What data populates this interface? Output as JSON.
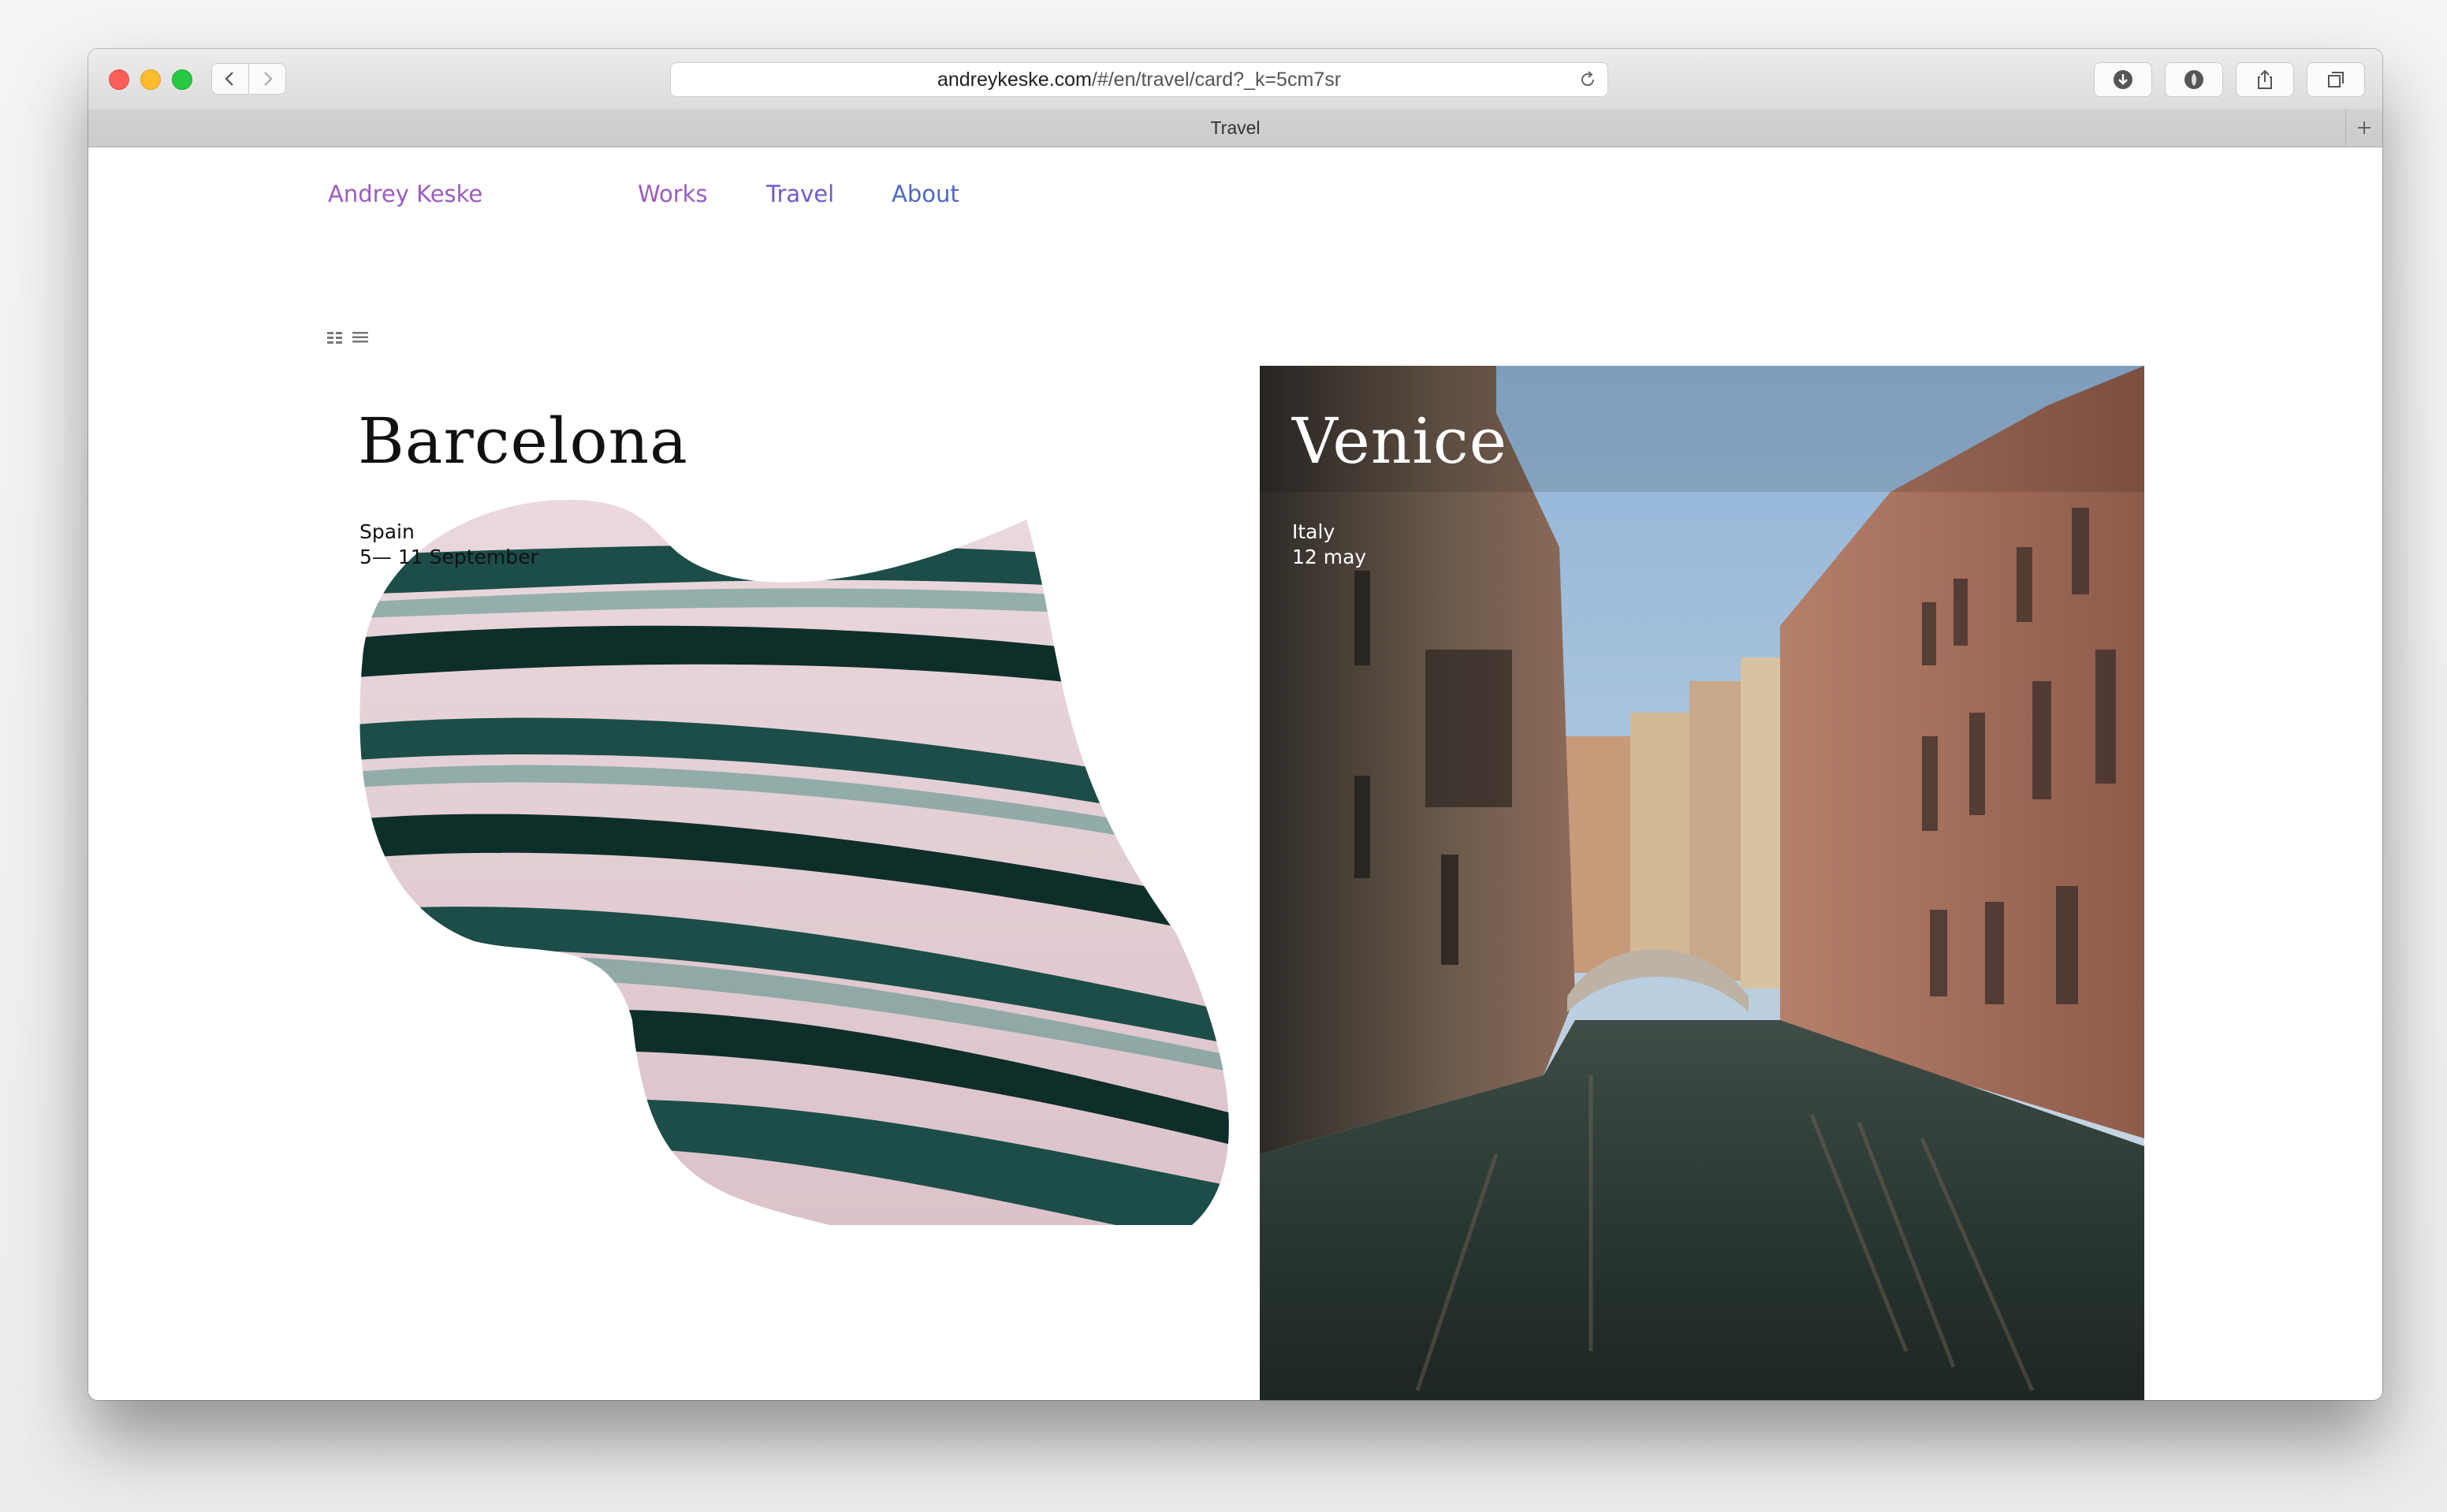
{
  "browser": {
    "url_host": "andreykeske.com",
    "url_path": "/#/en/travel/card?_k=5cm7sr",
    "tab_title": "Travel"
  },
  "site": {
    "title": "Andrey Keske",
    "nav": [
      {
        "label": "Works",
        "color": "#9b5cc0"
      },
      {
        "label": "Travel",
        "color": "#6b5fc6"
      },
      {
        "label": "About",
        "color": "#4f66c4"
      }
    ]
  },
  "view_toggle": {
    "icons": [
      "grid-view-icon",
      "list-view-icon"
    ]
  },
  "cards": [
    {
      "title": "Barcelona",
      "country": "Spain",
      "dates": "5— 11 September",
      "text_color": "#111111"
    },
    {
      "title": "Venice",
      "country": "Italy",
      "dates": "12 may",
      "text_color": "#ffffff"
    }
  ]
}
